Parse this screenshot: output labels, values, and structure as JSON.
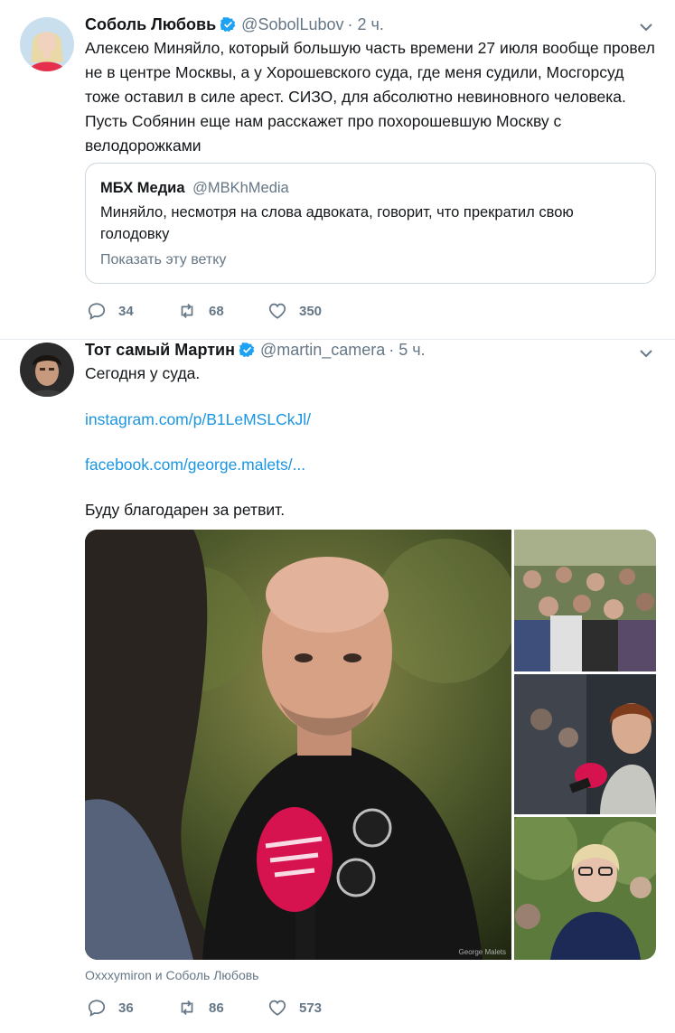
{
  "tweets": [
    {
      "author": {
        "name": "Соболь Любовь",
        "handle": "@SobolLubov",
        "verified": true
      },
      "time": "2 ч.",
      "text": "Алексею Миняйло, который большую часть времени 27 июля вообще провел не в центре Москвы, а у Хорошевского суда, где меня судили, Мосгорсуд тоже оставил в силе арест. СИЗО, для абсолютно невиновного человека. Пусть Собянин еще нам расскажет про похорошевшую Москву с велодорожками",
      "quoted": {
        "name": "МБХ Медиа",
        "handle": "@MBKhMedia",
        "text": "Миняйло, несмотря на слова адвоката, говорит, что прекратил свою голодовку",
        "show_thread": "Показать эту ветку"
      },
      "stats": {
        "replies": "34",
        "retweets": "68",
        "likes": "350"
      }
    },
    {
      "author": {
        "name": "Тот самый Мартин",
        "handle": "@martin_camera",
        "verified": true
      },
      "time": "5 ч.",
      "text_line1": "Сегодня у суда.",
      "link1": "instagram.com/p/B1LeMSLCkJl/",
      "link2": "facebook.com/george.malets/...",
      "text_line2": "Буду благодарен за ретвит.",
      "media_watermark": "George Malets",
      "tagged": "Oxxxymiron и Соболь Любовь",
      "stats": {
        "replies": "36",
        "retweets": "86",
        "likes": "573"
      }
    }
  ],
  "colors": {
    "accent": "#1da1f2",
    "link": "#1b95e0",
    "muted": "#657786",
    "mic": "#d6124f"
  }
}
